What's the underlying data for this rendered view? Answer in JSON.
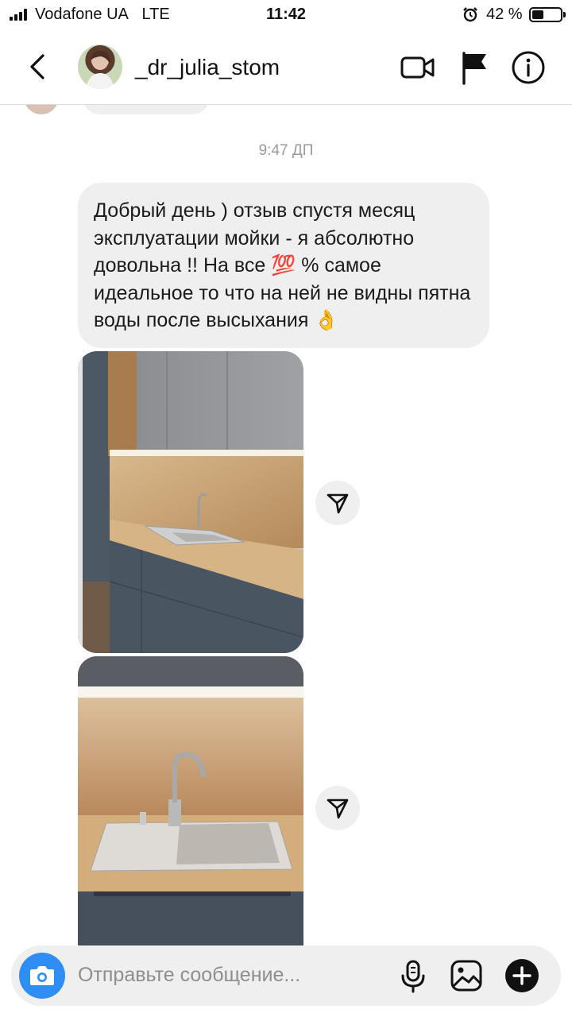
{
  "status_bar": {
    "carrier": "Vodafone UA",
    "network": "LTE",
    "time": "11:42",
    "battery_percent": "42 %",
    "battery_level": 0.42,
    "icons": [
      "signal-icon",
      "alarm-icon",
      "battery-icon"
    ]
  },
  "header": {
    "username": "_dr_julia_stom",
    "icons": [
      "back-chevron-icon",
      "video-call-icon",
      "flag-icon",
      "info-icon"
    ]
  },
  "chat": {
    "timestamp": "9:47 ДП",
    "message_text": "Добрый день ) отзыв спустя месяц эксплуатации мойки - я абсолютно довольна !! На все 💯 % самое идеальное то что на ней не видны пятна воды после высыхания 👌",
    "attachments": [
      "kitchen-photo-icon",
      "sink-photo-icon"
    ],
    "share_icon": "paper-plane-icon"
  },
  "composer": {
    "placeholder": "Отправьте сообщение...",
    "icons": [
      "camera-icon",
      "microphone-icon",
      "gallery-icon",
      "plus-icon"
    ]
  },
  "colors": {
    "accent": "#2f8ef5",
    "bubble": "#efefef",
    "timestamp": "#9a9a9a"
  }
}
